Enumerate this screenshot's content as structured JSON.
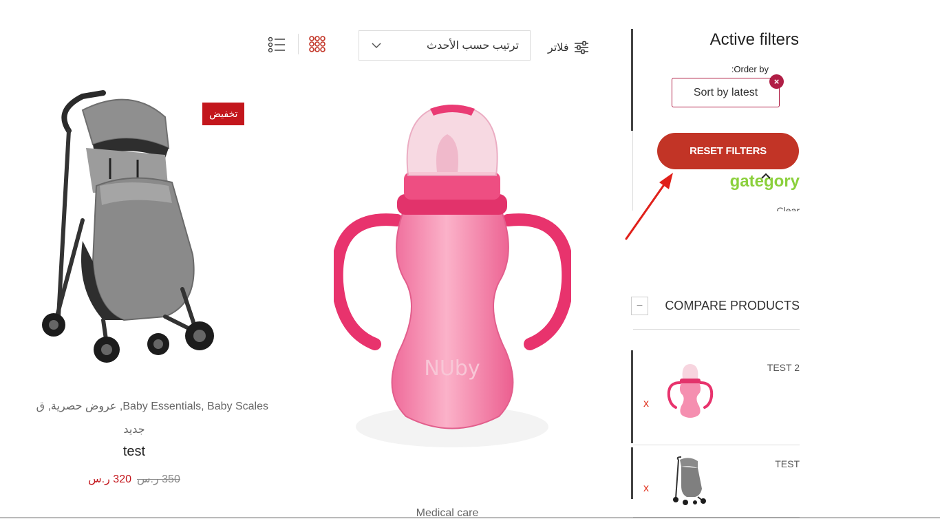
{
  "toolbar": {
    "filter_label": "فلاتر",
    "sort_value": "ترتيب حسب الأحدث",
    "grid_icon": "grid-view-icon",
    "list_icon": "list-view-icon"
  },
  "products": [
    {
      "badge": "تخفيض",
      "categories_line1": "Baby Essentials, Baby Scales, عروض حصرية, ق",
      "categories_line2": "جديد",
      "title": "test",
      "price_old": "350 ر.س",
      "price_new": "320 ر.س",
      "image": "stroller"
    },
    {
      "category": "Medical care",
      "image": "baby-bottle",
      "brand_text": "NUby"
    }
  ],
  "sidebar": {
    "active_filters_title": "Active filters",
    "order_by_label": ":Order by",
    "sort_chip": "Sort by latest",
    "chip_close": "×",
    "reset_button": "RESET FILTERS",
    "category_label": "gategory",
    "clear_label": "Clear",
    "compare": {
      "toggle": "−",
      "title": "COMPARE PRODUCTS",
      "items": [
        {
          "name": "TEST 2",
          "remove": "x",
          "image": "baby-bottle"
        },
        {
          "name": "TEST",
          "remove": "x",
          "image": "stroller"
        }
      ]
    }
  },
  "colors": {
    "accent_red": "#c23426",
    "badge_red": "#c3161c",
    "chip_border": "#b01e45",
    "category_green": "#8bd03c",
    "annotation_arrow": "#e0201a"
  }
}
